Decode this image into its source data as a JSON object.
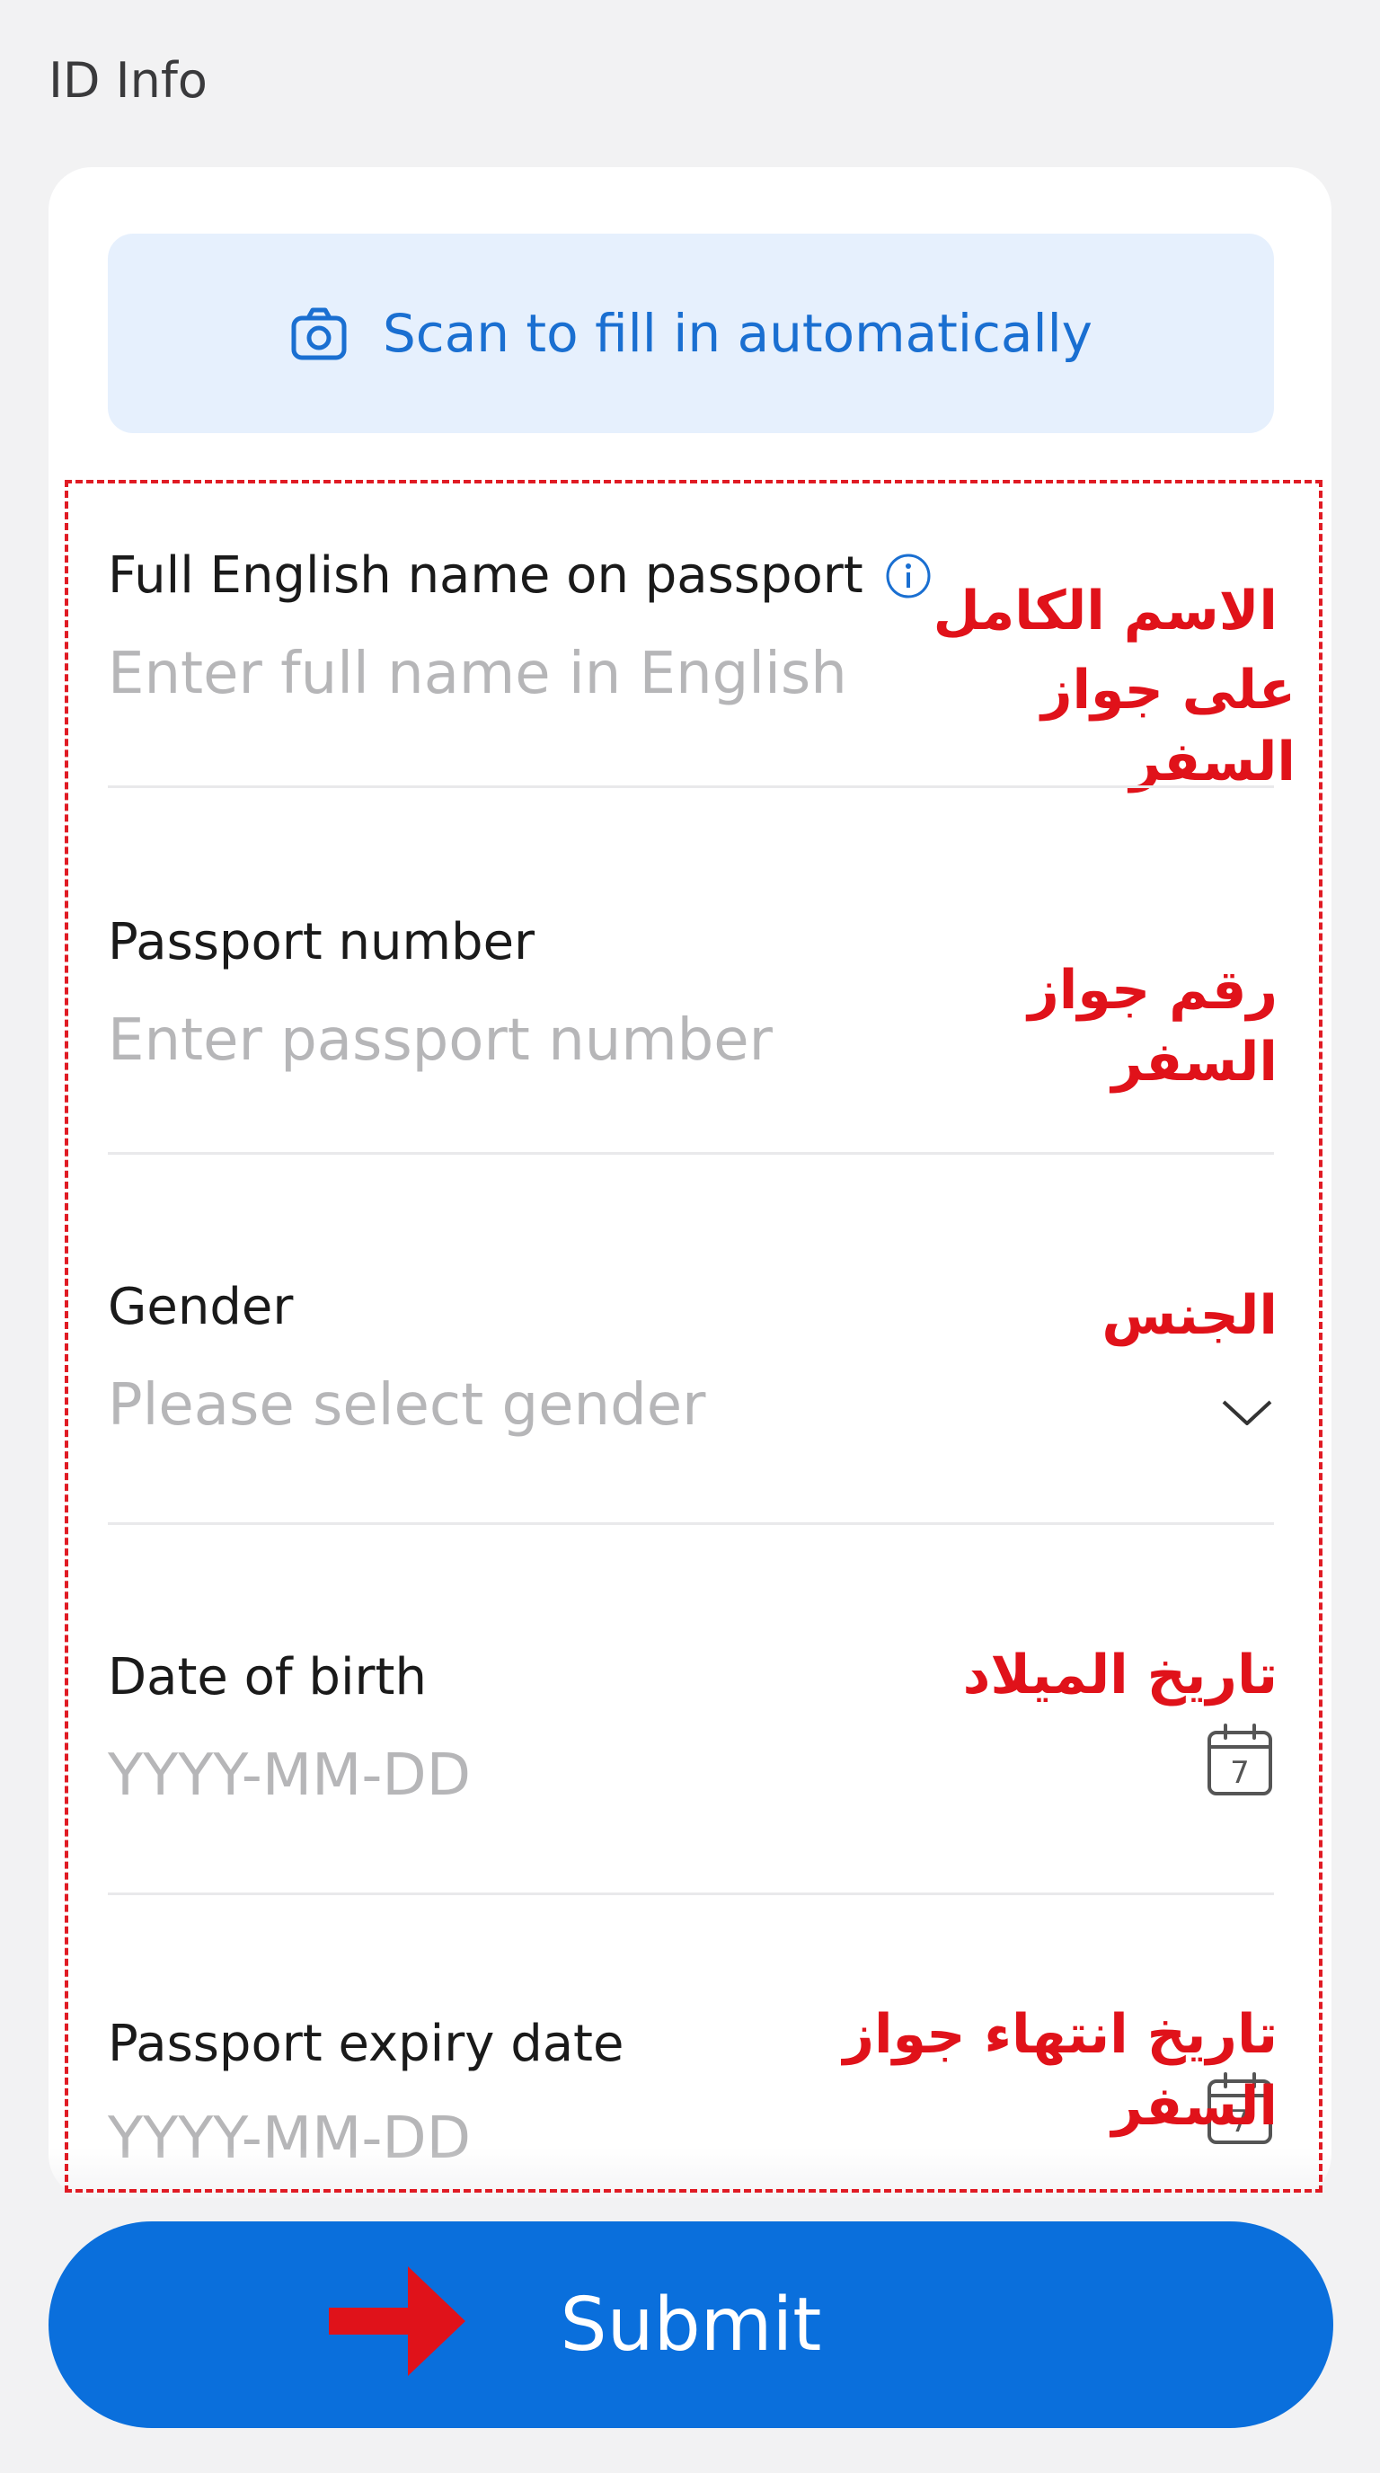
{
  "page": {
    "title": "ID Info"
  },
  "scan": {
    "label": "Scan to fill in automatically",
    "icon": "camera-icon"
  },
  "fields": [
    {
      "label": "Full English name on passport",
      "placeholder": "Enter full name in English",
      "annotation_line1": "الاسم الكامل",
      "annotation_line2": "على جواز السفر",
      "icon": "info-icon"
    },
    {
      "label": "Passport number",
      "placeholder": "Enter passport number",
      "annotation": "رقم جواز السفر"
    },
    {
      "label": "Gender",
      "placeholder": "Please select gender",
      "annotation": "الجنس",
      "icon": "chevron-down-icon"
    },
    {
      "label": "Date of birth",
      "placeholder": "YYYY-MM-DD",
      "annotation": "تاريخ الميلاد",
      "icon": "calendar-icon",
      "calendar_day": "7"
    },
    {
      "label": "Passport expiry date",
      "placeholder": "YYYY-MM-DD",
      "annotation": "تاريخ انتهاء جواز السفر",
      "icon": "calendar-icon",
      "calendar_day": "7"
    }
  ],
  "submit": {
    "label": "Submit"
  },
  "colors": {
    "accent": "#0a6fdc",
    "annotation": "#e0121a",
    "scan_bg": "#e6f0fd"
  }
}
